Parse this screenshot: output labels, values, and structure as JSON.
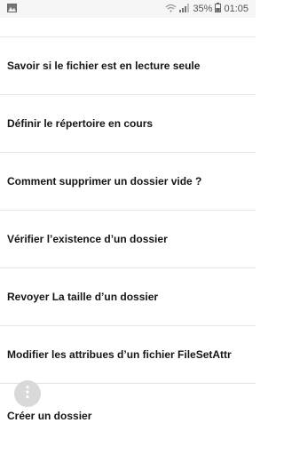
{
  "statusbar": {
    "battery_percent": "35%",
    "time": "01:05",
    "icons": [
      "gallery-icon",
      "wifi-icon",
      "signal-icon",
      "battery-icon"
    ]
  },
  "list": {
    "items": [
      {
        "label": "Savoir si le fichier est en lecture seule"
      },
      {
        "label": "Définir le répertoire en cours"
      },
      {
        "label": "Comment supprimer un dossier vide ?"
      },
      {
        "label": "Vérifier l’existence d’un dossier"
      },
      {
        "label": "Revoyer La taille d’un dossier"
      },
      {
        "label": "Modifier les attribues d’un fichier FileSetAttr"
      },
      {
        "label": "Créer un dossier"
      }
    ]
  },
  "fab": {
    "icon": "more-vertical-icon"
  },
  "colors": {
    "status_bg": "#f6f6f6",
    "fab_bg": "#d9d9d9",
    "divider": "#e3e3e3"
  }
}
